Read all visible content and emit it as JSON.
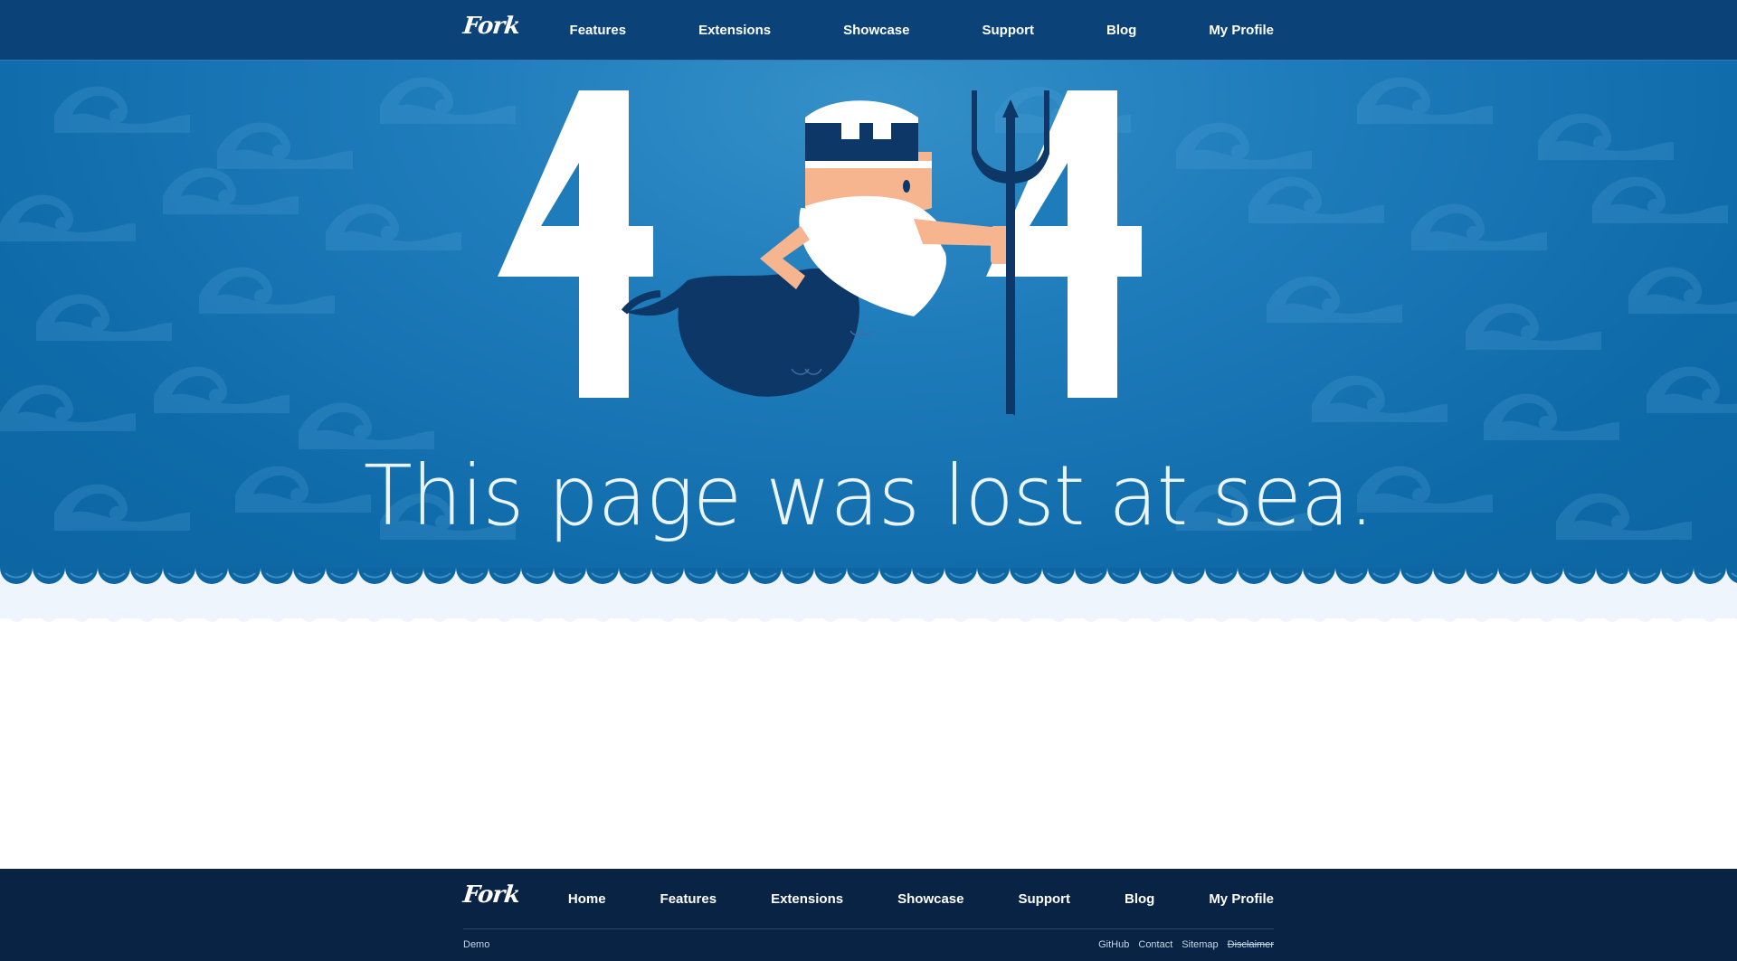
{
  "nav": {
    "logo": "Fork",
    "items": [
      {
        "label": "Features"
      },
      {
        "label": "Extensions"
      },
      {
        "label": "Showcase"
      },
      {
        "label": "Support"
      },
      {
        "label": "Blog"
      },
      {
        "label": "My Profile"
      }
    ]
  },
  "hero": {
    "error_code_left": "4",
    "error_code_right": "4",
    "headline": "This page was lost at sea.",
    "illustration_icon": "neptune-mascot-icon"
  },
  "footer": {
    "logo": "Fork",
    "items": [
      {
        "label": "Home"
      },
      {
        "label": "Features"
      },
      {
        "label": "Extensions"
      },
      {
        "label": "Showcase"
      },
      {
        "label": "Support"
      },
      {
        "label": "Blog"
      },
      {
        "label": "My Profile"
      }
    ],
    "left_link": "Demo",
    "links": [
      {
        "label": "GitHub"
      },
      {
        "label": "Contact"
      },
      {
        "label": "Sitemap"
      },
      {
        "label": "Disclaimer"
      }
    ]
  },
  "colors": {
    "nav_bg": "#0b4278",
    "hero_blue": "#1f7cbb",
    "dark_navy": "#0d3766",
    "skin": "#f6b58e",
    "footer_bg": "#082344",
    "foam": "#eef5fc"
  }
}
